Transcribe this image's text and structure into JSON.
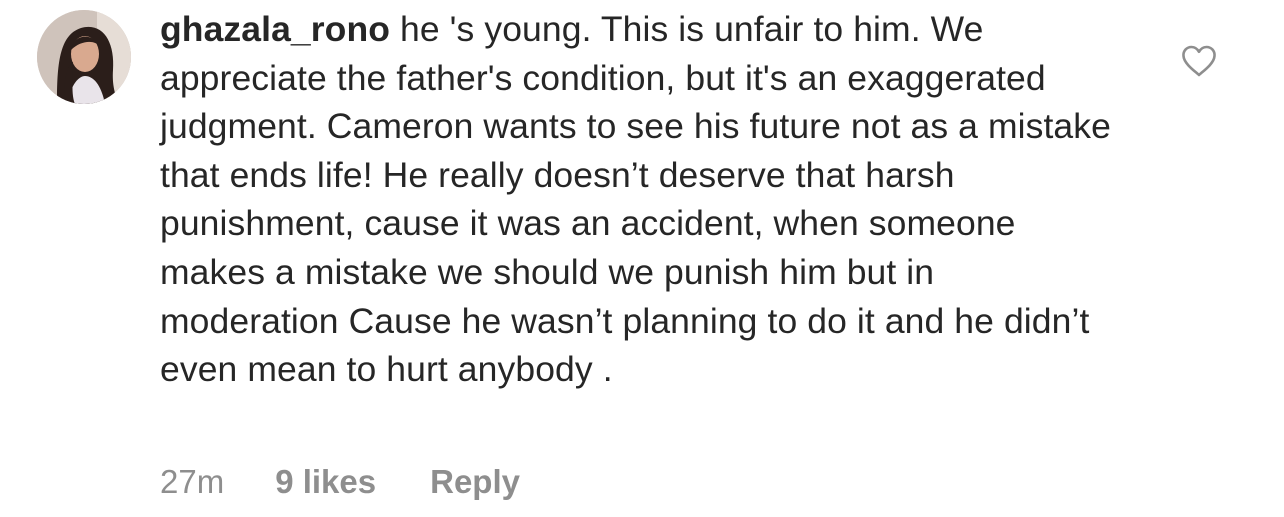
{
  "comment": {
    "username": "ghazala_rono",
    "text": "he 's young. This is unfair to him. We appreciate the father's condition, but it's an exaggerated judgment. Cameron wants to see his future not as a mistake that ends life! He really doesn’t deserve that harsh punishment, cause it was an accident, when someone makes a mistake we should we punish him but in moderation Cause he wasn’t planning to do it and he didn’t even mean to hurt anybody .",
    "time": "27m",
    "likes": "9 likes",
    "reply_label": "Reply",
    "avatar_icon": "profile-photo",
    "like_icon": "heart-outline-icon"
  },
  "colors": {
    "text": "#262626",
    "meta": "#8e8e8e",
    "icon": "#8e8e8e"
  }
}
